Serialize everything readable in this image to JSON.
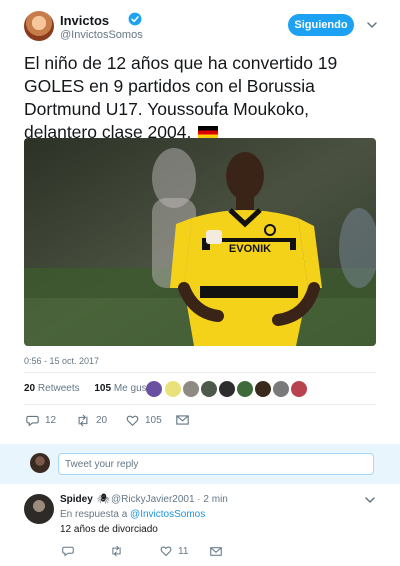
{
  "tweet": {
    "author_name": "Invictos",
    "author_handle": "@InvictosSomos",
    "follow_label": "Siguiendo",
    "text": "El niño de 12 años que ha convertido 19 GOLES en 9 partidos con el Borussia Dortmund U17. Youssoufa Moukoko, delantero clase 2004.",
    "jersey_sponsor": "EVONIK",
    "timestamp": "0:56 - 15 oct. 2017",
    "retweets_count": "20",
    "retweets_label": "Retweets",
    "likes_count": "105",
    "likes_label": "Me gusta",
    "actions": {
      "reply_count": "12",
      "retweet_count": "20",
      "like_count": "105"
    }
  },
  "reply_box": {
    "placeholder": "Tweet your reply"
  },
  "reply": {
    "author_name": "Spidey",
    "author_handle": "@RickyJavier2001",
    "time": "· 2 min",
    "in_reply_prefix": "En respuesta a",
    "in_reply_handle": "@InvictosSomos",
    "text": "12 años de divorciado",
    "actions": {
      "reply_count": "",
      "retweet_count": "",
      "like_count": "11"
    }
  },
  "colors": {
    "accent": "#1da1f2",
    "jersey_yellow": "#f4d21a"
  }
}
